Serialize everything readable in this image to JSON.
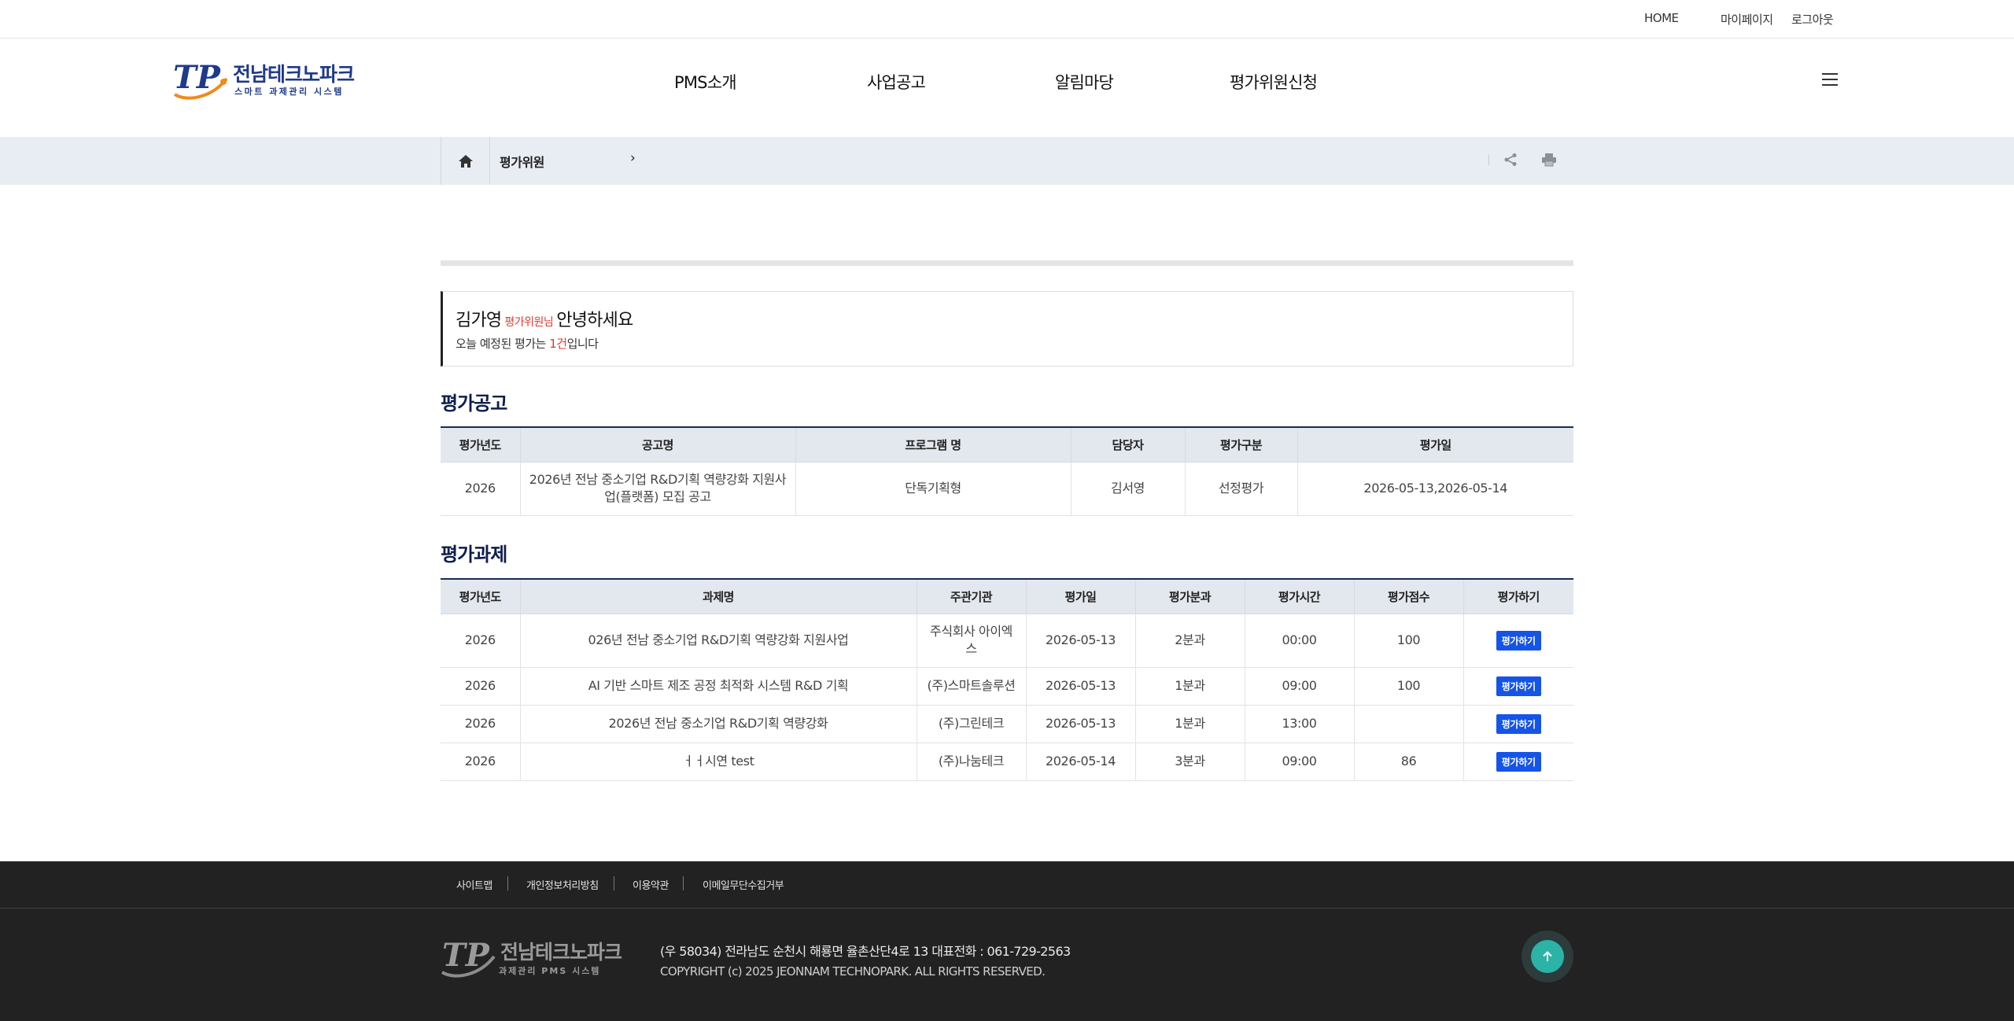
{
  "util_nav": {
    "home": "HOME",
    "mypage": "마이페이지",
    "logout": "로그아웃"
  },
  "logo": {
    "title": "전남테크노파크",
    "subtitle": "스마트 과제관리 시스템"
  },
  "gnb": [
    "PMS소개",
    "사업공고",
    "알림마당",
    "평가위원신청"
  ],
  "icons": {
    "menu": "hamburger-icon",
    "home": "home-icon",
    "share": "share-icon",
    "print": "print-icon",
    "top": "arrow-up-icon"
  },
  "location": {
    "current": "평가위원",
    "arrow": "›"
  },
  "greeting": {
    "name": "김가영",
    "role": "평가위원님",
    "hello": "안녕하세요",
    "prefix": "오늘 예정된 평가는 ",
    "count": "1건",
    "suffix": "입니다"
  },
  "announce": {
    "title": "평가공고",
    "headers": [
      "평가년도",
      "공고명",
      "프로그램 명",
      "담당자",
      "평가구분",
      "평가일"
    ],
    "rows": [
      [
        "2026",
        "2026년 전남 중소기업 R&D기획 역량강화 지원사업(플랫폼) 모집 공고",
        "단독기획형",
        "김서영",
        "선정평가",
        "2026-05-13,2026-05-14"
      ]
    ]
  },
  "tasks": {
    "title": "평가과제",
    "headers": [
      "평가년도",
      "과제명",
      "주관기관",
      "평가일",
      "평가분과",
      "평가시간",
      "평가점수",
      "평가하기"
    ],
    "button_label": "평가하기",
    "rows": [
      [
        "2026",
        "026년 전남 중소기업 R&D기획 역량강화 지원사업",
        "주식회사 아이엑스",
        "2026-05-13",
        "2분과",
        "00:00",
        "100"
      ],
      [
        "2026",
        "AI 기반 스마트 제조 공정 최적화 시스템 R&D 기획",
        "(주)스마트솔루션",
        "2026-05-13",
        "1분과",
        "09:00",
        "100"
      ],
      [
        "2026",
        "2026년 전남 중소기업 R&D기획 역량강화",
        "(주)그린테크",
        "2026-05-13",
        "1분과",
        "13:00",
        ""
      ],
      [
        "2026",
        "ㅓㅓ시연 test",
        "(주)나눔테크",
        "2026-05-14",
        "3분과",
        "09:00",
        "86"
      ]
    ]
  },
  "footer": {
    "nav": [
      "사이트맵",
      "개인정보처리방침",
      "이용약관",
      "이메일무단수집거부"
    ],
    "logo_title": "전남테크노파크",
    "logo_sub": "과제관리 PMS 시스템",
    "address": "(우 58034) 전라남도 순천시 해룡면 율촌산단4로 13   대표전화 : 061-729-2563",
    "copyright": "COPYRIGHT (c) 2025 JEONNAM TECHNOPARK. ALL RIGHTS RESERVED."
  },
  "colors": {
    "brand_navy": "#1f3a8a",
    "accent_orange": "#f08a1c",
    "btn_blue": "#1554e8",
    "alert_red": "#e2392f",
    "top_btn_teal": "#2bb3a8"
  }
}
